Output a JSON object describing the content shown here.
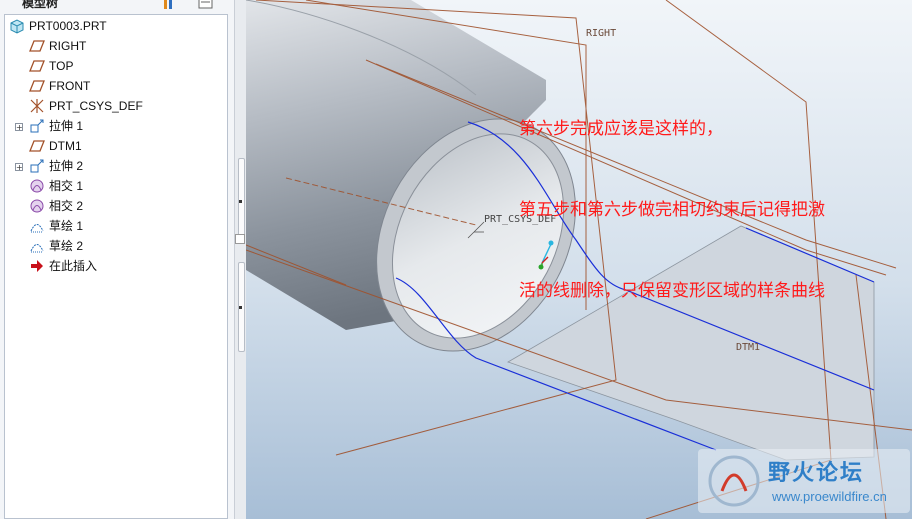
{
  "model_tree": {
    "title": "模型树",
    "items": [
      {
        "label": "PRT0003.PRT",
        "icon": "part-icon"
      },
      {
        "label": "RIGHT",
        "icon": "datum-plane-icon"
      },
      {
        "label": "TOP",
        "icon": "datum-plane-icon"
      },
      {
        "label": "FRONT",
        "icon": "datum-plane-icon"
      },
      {
        "label": "PRT_CSYS_DEF",
        "icon": "coordinate-system-icon"
      },
      {
        "label": "拉伸 1",
        "icon": "extrude-icon"
      },
      {
        "label": "DTM1",
        "icon": "datum-plane-icon"
      },
      {
        "label": "拉伸 2",
        "icon": "extrude-icon"
      },
      {
        "label": "相交 1",
        "icon": "intersect-icon"
      },
      {
        "label": "相交 2",
        "icon": "intersect-icon"
      },
      {
        "label": "草绘 1",
        "icon": "sketch-icon"
      },
      {
        "label": "草绘 2",
        "icon": "sketch-icon"
      },
      {
        "label": "在此插入",
        "icon": "insert-here-arrow-icon"
      }
    ]
  },
  "viewport": {
    "datum_labels": {
      "right": "RIGHT",
      "dtm1": "DTM1",
      "csys": "PRT_CSYS_DEF"
    },
    "annotation_lines": [
      "第六步完成应该是这样的，",
      "第五步和第六步做完相切约束后记得把激",
      "活的线删除，只保留变形区域的样条曲线"
    ],
    "colors": {
      "annotation": "#ff1a1a",
      "curve": "#1a2fd8",
      "datum": "#a0522d",
      "background_top": "#eef3f8",
      "background_bottom": "#a9c0d8"
    }
  },
  "watermark": {
    "title": "野火论坛",
    "url": "www.proewildfire.cn"
  }
}
